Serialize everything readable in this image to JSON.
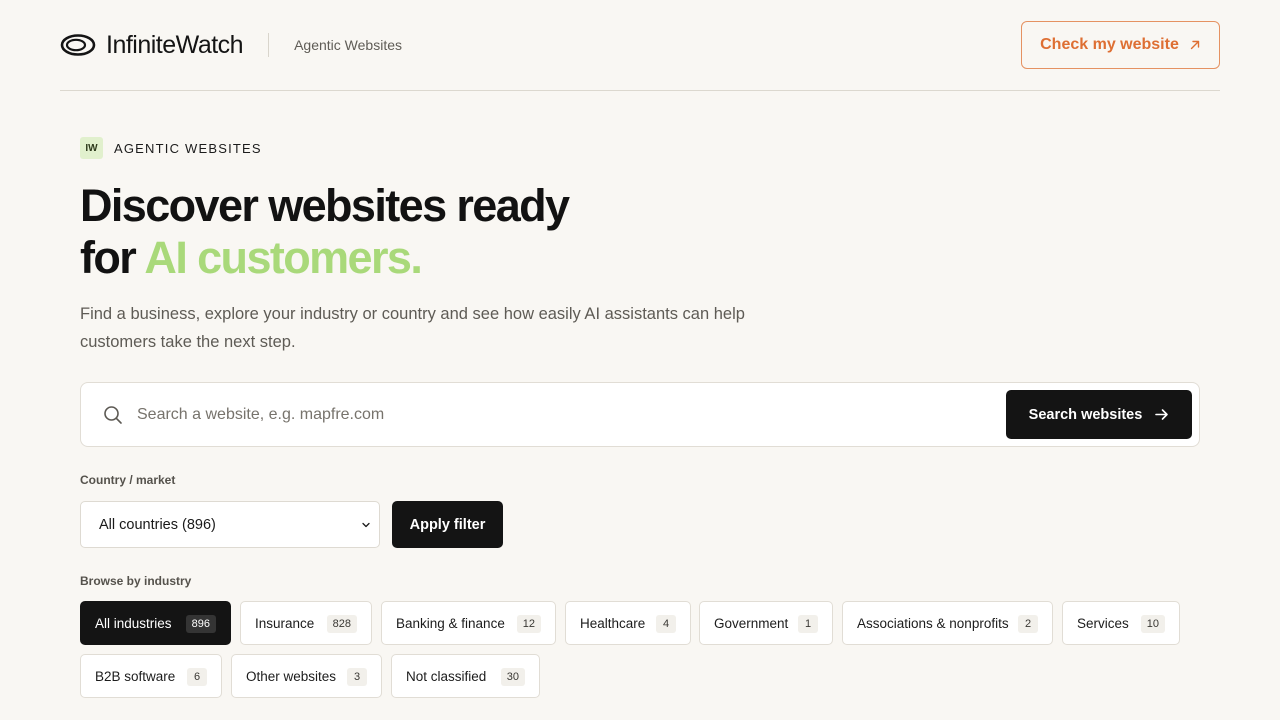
{
  "header": {
    "brand_name": "InfiniteWatch",
    "brand_sub": "Agentic Websites",
    "cta_label": "Check my website"
  },
  "eyebrow": {
    "badge": "IW",
    "text": "AGENTIC WEBSITES"
  },
  "hero": {
    "title_line1": "Discover websites ready",
    "title_line2_prefix": "for ",
    "title_line2_accent": "AI customers.",
    "description": "Find a business, explore your industry or country and see how easily AI assistants can help customers take the next step."
  },
  "search": {
    "placeholder": "Search a website, e.g. mapfre.com",
    "button_label": "Search websites"
  },
  "filter": {
    "country_label": "Country / market",
    "country_selected": "All countries (896)",
    "apply_label": "Apply filter"
  },
  "industries": {
    "label": "Browse by industry",
    "chips": [
      {
        "label": "All industries",
        "count": "896",
        "active": true
      },
      {
        "label": "Insurance",
        "count": "828"
      },
      {
        "label": "Banking & finance",
        "count": "12"
      },
      {
        "label": "Healthcare",
        "count": "4"
      },
      {
        "label": "Government",
        "count": "1"
      },
      {
        "label": "Associations & nonprofits",
        "count": "2"
      },
      {
        "label": "Services",
        "count": "10"
      },
      {
        "label": "B2B software",
        "count": "6"
      },
      {
        "label": "Other websites",
        "count": "3"
      },
      {
        "label": "Not classified",
        "count": "30"
      }
    ]
  },
  "colors": {
    "accent_green": "#a9d97a",
    "accent_orange": "#de6f33",
    "dark": "#141414",
    "background": "#f9f7f3"
  },
  "icons": {
    "logo": "infinite-loop-icon",
    "cta": "arrow-up-right-icon",
    "search": "search-icon",
    "search_button": "arrow-right-icon",
    "select": "chevron-down-icon"
  }
}
